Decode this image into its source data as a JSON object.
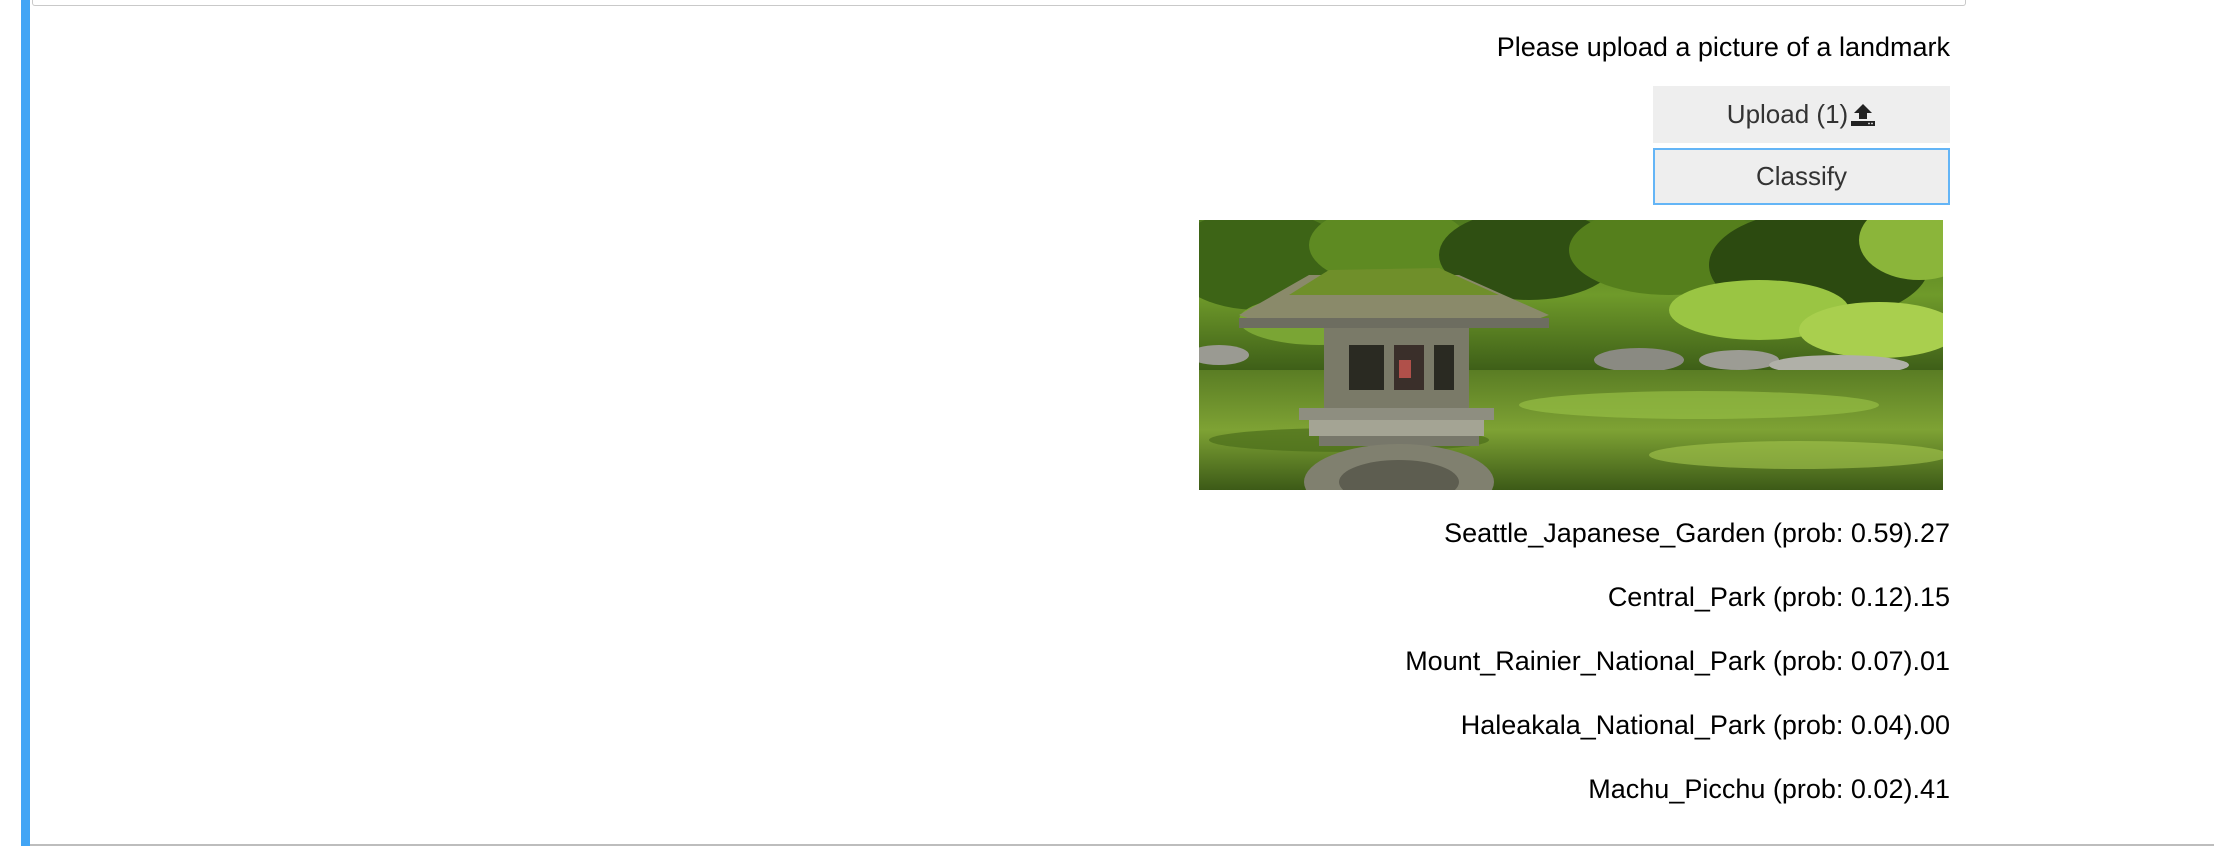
{
  "prompt": "Please upload a picture of a landmark",
  "buttons": {
    "upload_label": "Upload (1)",
    "classify_label": "Classify"
  },
  "icons": {
    "upload": "upload-icon"
  },
  "colors": {
    "accent_bar": "#42a5f5",
    "button_bg": "#eeeeee",
    "focus_border": "#64b5f6"
  },
  "results": [
    {
      "text": "Seattle_Japanese_Garden (prob: 0.59).27"
    },
    {
      "text": "Central_Park (prob: 0.12).15"
    },
    {
      "text": "Mount_Rainier_National_Park (prob: 0.07).01"
    },
    {
      "text": "Haleakala_National_Park (prob: 0.04).00"
    },
    {
      "text": "Machu_Picchu (prob: 0.02).41"
    }
  ]
}
